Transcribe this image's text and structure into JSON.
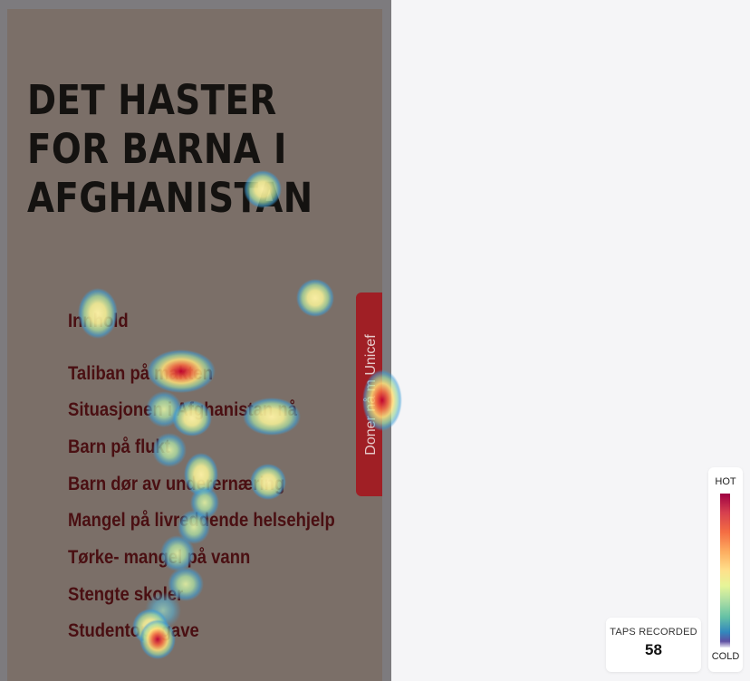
{
  "page": {
    "headline_lines": [
      "DET HASTER",
      "FOR BARNA I",
      "AFGHANISTAN"
    ],
    "toc": [
      {
        "label": "Innhold"
      },
      {
        "label": "Taliban på makten"
      },
      {
        "label": "Situasjonen i Afghanistan nå"
      },
      {
        "label": "Barn på flukt"
      },
      {
        "label": "Barn dør av underernæring"
      },
      {
        "label": "Mangel på livreddende helsehjelp"
      },
      {
        "label": "Tørke- mangel på vann"
      },
      {
        "label": "Stengte skoler"
      },
      {
        "label": "Studentoppgave"
      }
    ],
    "donate_tab_label": "Doner nå m Unicef"
  },
  "heatmap": {
    "palette": {
      "hot": "#c2002e",
      "warm": "#ffe27a",
      "mid": "#bfe8a4",
      "cool": "#3e9fd6"
    },
    "taps_title": "TAPS RECORDED",
    "taps_count": "58",
    "legend": {
      "hot_label": "HOT",
      "cold_label": "COLD"
    }
  }
}
